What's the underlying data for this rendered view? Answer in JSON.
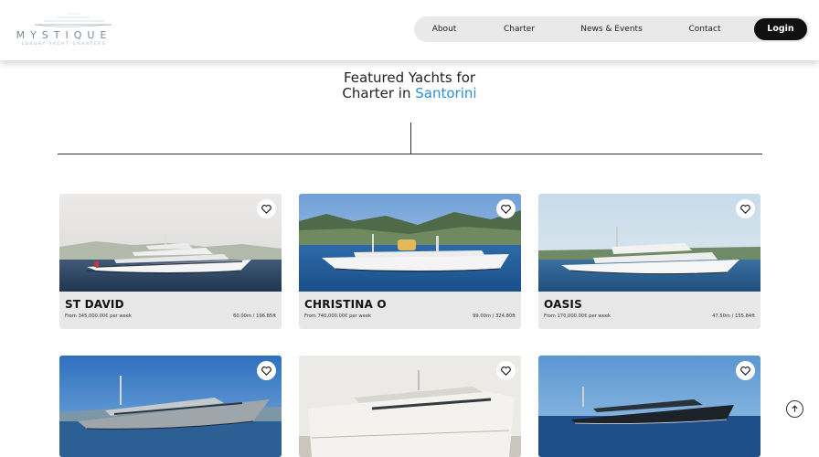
{
  "logo": {
    "wordmark": "MYSTIQUE",
    "tagline": "LUXURY YACHT CHARTERS"
  },
  "nav": {
    "items": [
      {
        "label": "About"
      },
      {
        "label": "Charter"
      },
      {
        "label": "News & Events"
      },
      {
        "label": "Contact"
      }
    ],
    "login_label": "Login"
  },
  "heading": {
    "line1": "Featured Yachts for",
    "line2_prefix": "Charter in",
    "location": "Santorini"
  },
  "yachts": [
    {
      "name": "ST DAVID",
      "price": "From 345,000.00€ per week",
      "size": "60.00m / 196.85ft"
    },
    {
      "name": "CHRISTINA O",
      "price": "From 740,000.00€ per week",
      "size": "99.00m / 324.80ft"
    },
    {
      "name": "OASIS",
      "price": "From 170,000.00€ per week",
      "size": "47.50m / 155.84ft"
    },
    {
      "name": "",
      "price": "",
      "size": ""
    },
    {
      "name": "",
      "price": "",
      "size": ""
    },
    {
      "name": "",
      "price": "",
      "size": ""
    }
  ],
  "colors": {
    "accent": "#2f8fd0",
    "login_bg": "#111111",
    "nav_bg": "#e9e9e9",
    "card_bg": "#e8e8e8"
  },
  "icons": {
    "favorite": "heart-icon",
    "scroll": "arrow-up-icon"
  }
}
